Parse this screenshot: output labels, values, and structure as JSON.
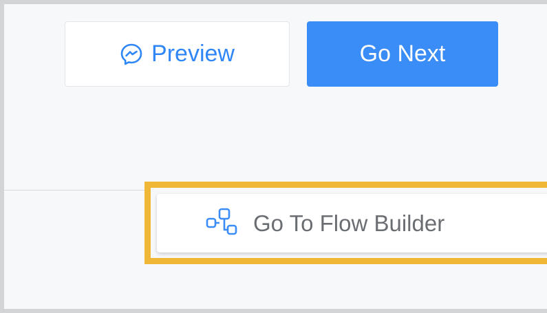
{
  "toolbar": {
    "preview_label": "Preview",
    "preview_icon": "messenger-icon",
    "go_next_label": "Go Next"
  },
  "flow": {
    "label": "Go To Flow Builder",
    "icon": "flow-builder-icon"
  },
  "colors": {
    "accent": "#3a8cf6",
    "highlight": "#efb735",
    "text_muted": "#6a6d72"
  }
}
